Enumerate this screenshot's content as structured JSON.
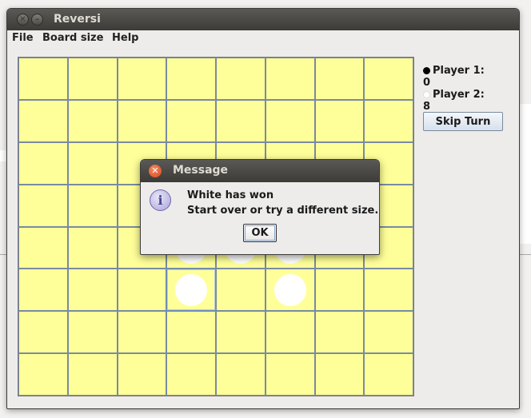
{
  "window": {
    "title": "Reversi"
  },
  "menu": {
    "items": [
      "File",
      "Board size",
      "Help"
    ]
  },
  "players": {
    "p1": {
      "label": "Player 1:",
      "score": "0"
    },
    "p2": {
      "label": "Player 2:",
      "score": "8"
    }
  },
  "skip_label": "Skip Turn",
  "board": {
    "rows": 8,
    "cols": 8,
    "cell_color": "#ffff99",
    "grid_color": "#7a8aa0",
    "white_pieces": [
      [
        4,
        3
      ],
      [
        4,
        4
      ],
      [
        4,
        5
      ],
      [
        5,
        3
      ],
      [
        5,
        5
      ]
    ],
    "selected_cell": [
      5,
      3
    ]
  },
  "dialog": {
    "title": "Message",
    "line1": "White has won",
    "line2": "Start over or try a different size.",
    "ok_label": "OK",
    "icon": "info-icon"
  },
  "icons": {
    "close": "close-icon",
    "minimize": "minimize-icon"
  }
}
